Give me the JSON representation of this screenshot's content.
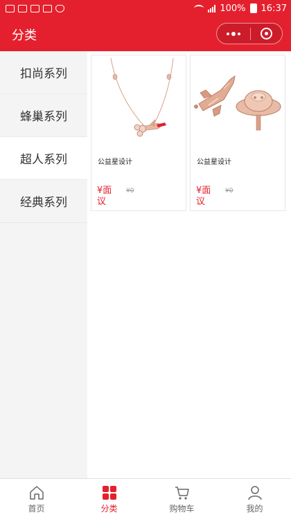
{
  "statusbar": {
    "battery": "100%",
    "time": "16:37"
  },
  "header": {
    "title": "分类"
  },
  "sidebar": {
    "items": [
      {
        "label": "扣尚系列"
      },
      {
        "label": "蜂巢系列"
      },
      {
        "label": "超人系列"
      },
      {
        "label": "经典系列"
      }
    ],
    "active_index": 2
  },
  "products": [
    {
      "name": "公益星设计",
      "price": "¥面议",
      "old_price": "¥0"
    },
    {
      "name": "公益星设计",
      "price": "¥面议",
      "old_price": "¥0"
    }
  ],
  "tabbar": {
    "tabs": [
      {
        "label": "首页",
        "icon": "home-icon"
      },
      {
        "label": "分类",
        "icon": "category-icon"
      },
      {
        "label": "购物车",
        "icon": "cart-icon"
      },
      {
        "label": "我的",
        "icon": "user-icon"
      }
    ],
    "active_index": 1
  },
  "colors": {
    "accent": "#e5202e",
    "product_gold": "#d9a08a"
  }
}
